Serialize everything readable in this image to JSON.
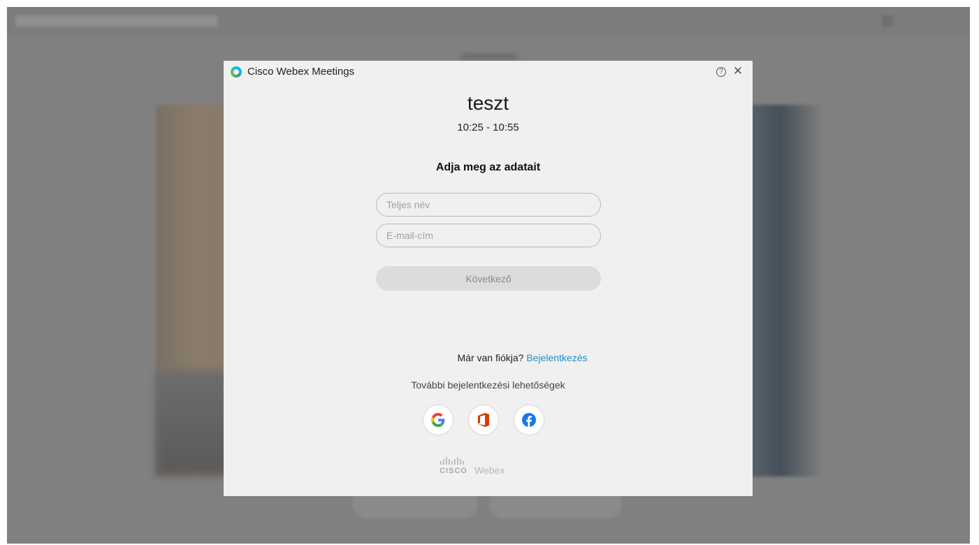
{
  "dialog": {
    "app_title": "Cisco Webex Meetings",
    "meeting": {
      "title": "teszt",
      "time": "10:25 - 10:55"
    },
    "form": {
      "heading": "Adja meg az adatait",
      "name_placeholder": "Teljes név",
      "email_placeholder": "E-mail-cím",
      "next_label": "Következő"
    },
    "account": {
      "question": "Már van fiókja?",
      "link": "Bejelentkezés"
    },
    "more_options": "További bejelentkezési lehetőségek",
    "social_icons": [
      "google-icon",
      "office-icon",
      "facebook-icon"
    ],
    "brand": {
      "company": "CISCO",
      "product": "Webex"
    }
  },
  "colors": {
    "link": "#1f8fbf",
    "dialog_bg": "#f0f0f0",
    "overlay": "#808080"
  }
}
